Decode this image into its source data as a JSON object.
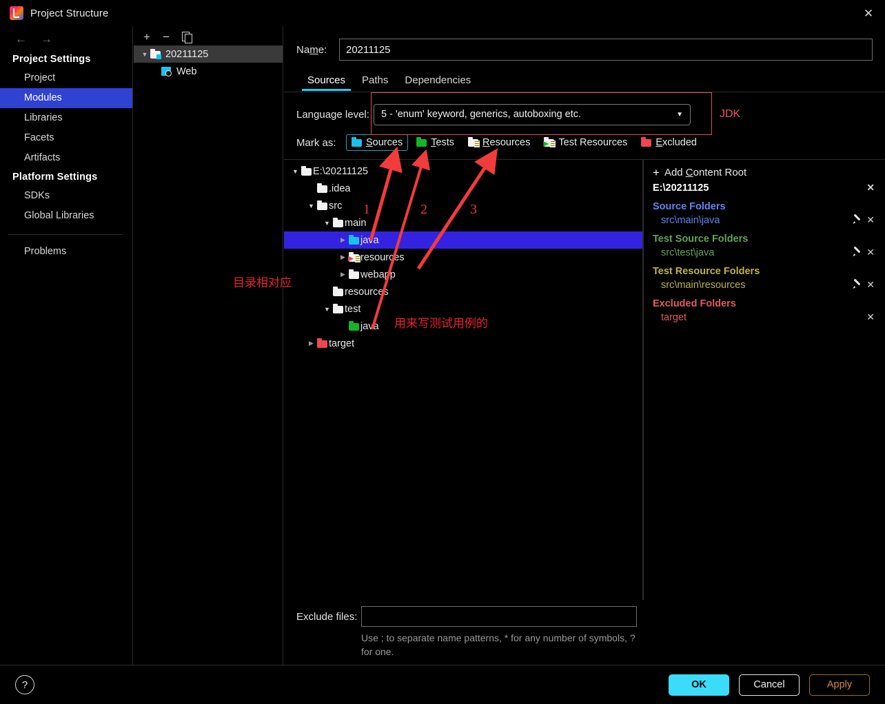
{
  "window": {
    "title": "Project Structure",
    "icon": "intellij-idea-icon",
    "close_label": "✕"
  },
  "sidebar": {
    "nav": {
      "back": "←",
      "forward": "→"
    },
    "groups": [
      {
        "label": "Project Settings",
        "items": [
          {
            "label": "Project",
            "selected": false
          },
          {
            "label": "Modules",
            "selected": true
          },
          {
            "label": "Libraries",
            "selected": false
          },
          {
            "label": "Facets",
            "selected": false
          },
          {
            "label": "Artifacts",
            "selected": false
          }
        ]
      },
      {
        "label": "Platform Settings",
        "items": [
          {
            "label": "SDKs",
            "selected": false
          },
          {
            "label": "Global Libraries",
            "selected": false
          }
        ]
      }
    ],
    "problems": "Problems"
  },
  "modules_panel": {
    "toolbar": {
      "add": "+",
      "remove": "−",
      "copy": "copy-icon"
    },
    "tree": [
      {
        "label": "20211125",
        "icon": "module-folder-icon",
        "twisty": "▼",
        "selected": true,
        "depth": 0
      },
      {
        "label": "Web",
        "icon": "web-facet-icon",
        "twisty": "",
        "selected": false,
        "depth": 1
      }
    ]
  },
  "main": {
    "name_label": "Name:",
    "name_value": "20211125",
    "tabs": [
      {
        "label": "Sources",
        "active": true
      },
      {
        "label": "Paths",
        "active": false
      },
      {
        "label": "Dependencies",
        "active": false
      }
    ],
    "language_level_label": "Language level:",
    "language_level_value": "5 - 'enum' keyword, generics, autoboxing etc.",
    "language_level_caret": "▼",
    "mark_as_label": "Mark as:",
    "mark_as_buttons": [
      {
        "label": "Sources",
        "accel": "S",
        "color": "#1ac1ee",
        "focused": true
      },
      {
        "label": "Tests",
        "accel": "T",
        "color": "#15b524",
        "focused": false
      },
      {
        "label": "Resources",
        "accel": "R",
        "color": "#f2f2f2",
        "focused": false
      },
      {
        "label": "Test Resources",
        "accel": "",
        "color": "#f2f2f2",
        "focused": false
      },
      {
        "label": "Excluded",
        "accel": "E",
        "color": "#f1454f",
        "focused": false
      }
    ],
    "file_tree": [
      {
        "label": "E:\\20211125",
        "depth": 0,
        "twisty": "▼",
        "icon": "folder-white",
        "selected": false
      },
      {
        "label": ".idea",
        "depth": 1,
        "twisty": "",
        "icon": "folder-white",
        "selected": false
      },
      {
        "label": "src",
        "depth": 1,
        "twisty": "▼",
        "icon": "folder-white",
        "selected": false
      },
      {
        "label": "main",
        "depth": 2,
        "twisty": "▼",
        "icon": "folder-white",
        "selected": false
      },
      {
        "label": "java",
        "depth": 3,
        "twisty": "▶",
        "icon": "folder-cyan",
        "selected": true
      },
      {
        "label": "resources",
        "depth": 3,
        "twisty": "▶",
        "icon": "folder-testresource",
        "selected": false
      },
      {
        "label": "webapp",
        "depth": 3,
        "twisty": "▶",
        "icon": "folder-white",
        "selected": false
      },
      {
        "label": "resources",
        "depth": 2,
        "twisty": "",
        "icon": "folder-white",
        "selected": false
      },
      {
        "label": "test",
        "depth": 2,
        "twisty": "▼",
        "icon": "folder-white",
        "selected": false
      },
      {
        "label": "java",
        "depth": 3,
        "twisty": "",
        "icon": "folder-green",
        "selected": false
      },
      {
        "label": "target",
        "depth": 1,
        "twisty": "▶",
        "icon": "folder-red",
        "selected": false
      }
    ],
    "exclude_files_label": "Exclude files:",
    "exclude_files_value": "",
    "exclude_hint_line1": "Use ; to separate name patterns, * for any number of",
    "exclude_hint_line2": "symbols, ? for one."
  },
  "content_roots": {
    "add_label": "Add Content Root",
    "add_accel": "C",
    "add_icon": "plus-icon",
    "root_path": "E:\\20211125",
    "groups": [
      {
        "title": "Source Folders",
        "color": "#5f86f2",
        "entries": [
          {
            "path": "src\\main\\java",
            "edit": true,
            "remove": true
          }
        ]
      },
      {
        "title": "Test Source Folders",
        "color": "#62a35a",
        "entries": [
          {
            "path": "src\\test\\java",
            "edit": true,
            "remove": true
          }
        ]
      },
      {
        "title": "Test Resource Folders",
        "color": "#bcb44a",
        "entries": [
          {
            "path": "src\\main\\resources",
            "edit": true,
            "remove": true
          }
        ]
      },
      {
        "title": "Excluded Folders",
        "color": "#e15b64",
        "entries": [
          {
            "path": "target",
            "edit": false,
            "remove": true
          }
        ]
      }
    ]
  },
  "footer": {
    "help": "?",
    "ok": "OK",
    "cancel": "Cancel",
    "apply": "Apply"
  },
  "annotations": {
    "jdk": "JDK",
    "num1": "1",
    "num2": "2",
    "num3": "3",
    "dir_match": "目录相对应",
    "test_case": "用来写测试用例的",
    "accent_red": "#e8242f"
  }
}
